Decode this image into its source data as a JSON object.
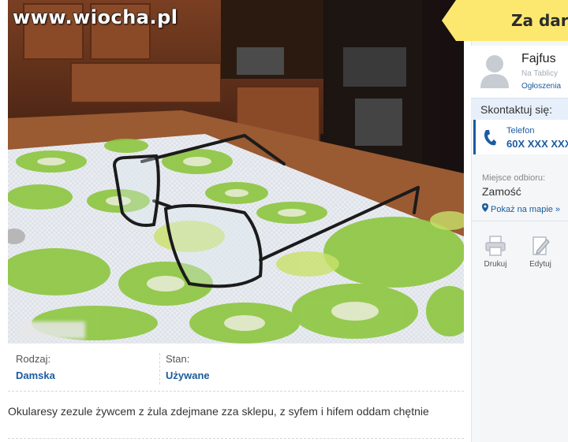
{
  "watermark": "www.wiocha.pl",
  "banner": {
    "text": "Za dar"
  },
  "user": {
    "name": "Fajfus",
    "since": "Na Tablicy",
    "ads_link": "Ogłoszenia"
  },
  "contact": {
    "title": "Skontaktuj się:",
    "phone_label": "Telefon",
    "phone_number": "60X XXX XXX"
  },
  "pickup": {
    "label": "Miejsce odbioru:",
    "city": "Zamość",
    "map_link": "Pokaż na mapie »"
  },
  "actions": [
    {
      "label": "Drukuj",
      "icon": "printer-icon"
    },
    {
      "label": "Edytuj",
      "icon": "edit-icon"
    }
  ],
  "details": [
    {
      "label": "Rodzaj:",
      "value": "Damska"
    },
    {
      "label": "Stan:",
      "value": "Używane"
    }
  ],
  "description": "Okularesy zezule żywcem z żula zdejmane zza sklepu, z syfem i hifem oddam chętnie",
  "colors": {
    "link_blue": "#1c5b9f",
    "banner_yellow": "#fde86f"
  }
}
